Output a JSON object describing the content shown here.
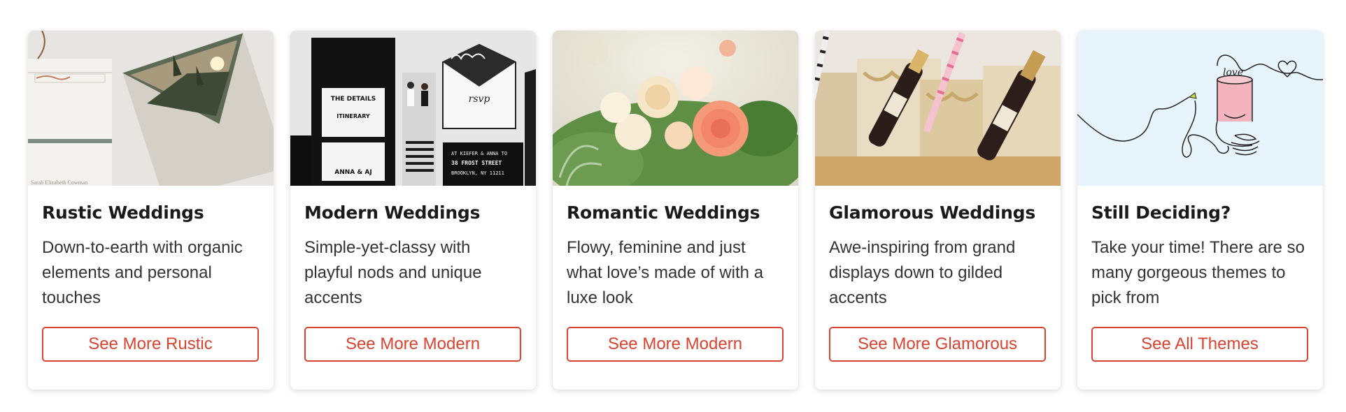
{
  "cards": [
    {
      "title": "Rustic Weddings",
      "description": "Down-to-earth with organic elements and personal touches",
      "button": "See More Rustic",
      "image": "rustic-invitation-photo",
      "invitation_text": "Sarah Elizabeth Cowman"
    },
    {
      "title": "Modern Weddings",
      "description": "Simple-yet-classy with playful nods and unique accents",
      "button": "See More Modern",
      "image": "modern-stationery-photo",
      "stationery": {
        "details": "THE DETAILS",
        "itinerary": "ITINERARY",
        "names": "ANNA & AJ",
        "rsvp": "rsvp",
        "address_line1": "AT KIEFER & ANNA TO",
        "address_line2": "38 FROST STREET",
        "address_line3": "BROOKLYN, NY 11211"
      }
    },
    {
      "title": "Romantic Weddings",
      "description": "Flowy, feminine and just what love’s made of with a luxe look",
      "button": "See More Modern",
      "image": "romantic-flowers-photo"
    },
    {
      "title": "Glamorous Weddings",
      "description": "Awe-inspiring from grand displays down to gilded accents",
      "button": "See More Glamorous",
      "image": "glamorous-champagne-photo"
    },
    {
      "title": "Still Deciding?",
      "description": "Take your time! There are so many gorgeous themes to pick from",
      "button": "See All Themes",
      "image": "line-art-cake-illustration",
      "cake_text": "love"
    }
  ],
  "colors": {
    "accent": "#d9432f",
    "title": "#1a1a1a",
    "body_text": "#333333",
    "illustration_bg": "#e8f4fc"
  }
}
